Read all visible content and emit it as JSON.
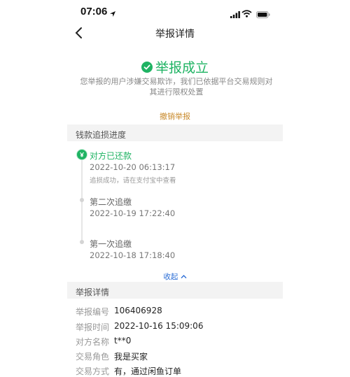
{
  "status_bar": {
    "time": "07:06"
  },
  "nav": {
    "title": "举报详情"
  },
  "result": {
    "title": "举报成立",
    "description": "您举报的用户涉嫌交易欺诈，我们已依据平台交易规则对其进行限权处置"
  },
  "cancel_label": "撤销举报",
  "progress": {
    "section_title": "钱款追损进度",
    "steps": [
      {
        "title": "对方已还款",
        "time": "2022-10-20 06:13:17",
        "note": "追损成功，请在支付宝中查看"
      },
      {
        "title": "第二次追缴",
        "time": "2022-10-19 17:22:40"
      },
      {
        "title": "第一次追缴",
        "time": "2022-10-18 17:18:40"
      }
    ],
    "collapse_label": "收起"
  },
  "details": {
    "section_title": "举报详情",
    "rows": [
      {
        "label": "举报编号",
        "value": "106406928"
      },
      {
        "label": "举报时间",
        "value": "2022-10-16 15:09:06"
      },
      {
        "label": "对方名称",
        "value": "t**0"
      },
      {
        "label": "交易角色",
        "value": "我是买家"
      },
      {
        "label": "交易方式",
        "value": "有，通过闲鱼订单"
      }
    ]
  },
  "colors": {
    "success": "#1fb363",
    "cancel": "#c98a2b",
    "link": "#2d6fd6"
  }
}
